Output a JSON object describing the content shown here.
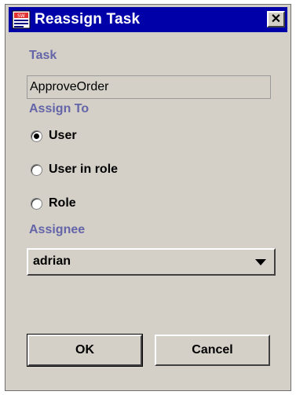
{
  "window": {
    "title": "Reassign Task",
    "close_symbol": "✕",
    "icon": "app-icon"
  },
  "task": {
    "label": "Task",
    "value": "ApproveOrder"
  },
  "assign_to": {
    "label": "Assign To",
    "options": [
      {
        "label": "User",
        "selected": true
      },
      {
        "label": "User in role",
        "selected": false
      },
      {
        "label": "Role",
        "selected": false
      }
    ]
  },
  "assignee": {
    "label": "Assignee",
    "selected": "adrian"
  },
  "buttons": {
    "ok_label": "OK",
    "cancel_label": "Cancel"
  },
  "colors": {
    "title_bar": "#0000a8",
    "dialog_bg": "#d4d0c8",
    "section_label": "#6464a8"
  }
}
